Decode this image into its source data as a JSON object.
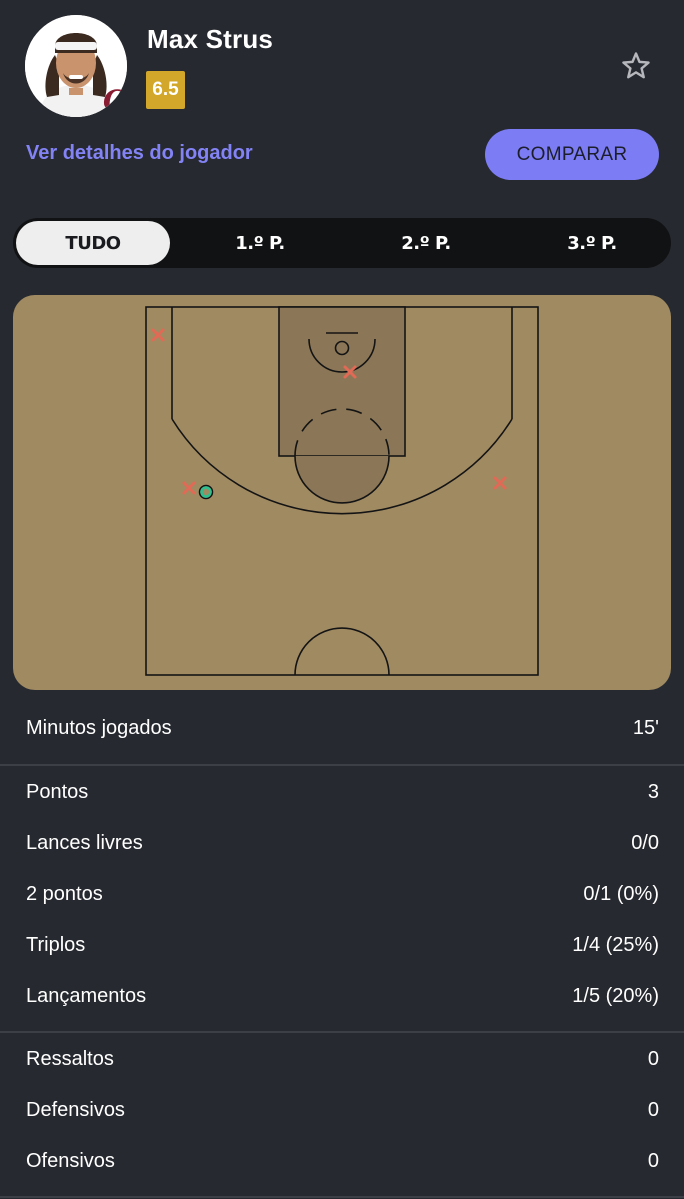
{
  "player": {
    "name": "Max Strus",
    "rating": "6.5",
    "details_link": "Ver detalhes do jogador",
    "compare_label": "COMPARAR",
    "accent_color": "#7c7cf4",
    "rating_color": "#d2a72a"
  },
  "tabs": [
    {
      "label": "TUDO",
      "active": true
    },
    {
      "label": "1.º P.",
      "active": false
    },
    {
      "label": "2.º P.",
      "active": false
    },
    {
      "label": "3.º P.",
      "active": false
    }
  ],
  "shot_chart": {
    "court_color": "#a08a62",
    "paint_color": "#8b7757",
    "made_color": "#2fbf8f",
    "missed_color": "#e06a55",
    "shots": [
      {
        "result": "missed",
        "type": "3PT",
        "zone": "left-corner"
      },
      {
        "result": "missed",
        "type": "2PT",
        "zone": "paint"
      },
      {
        "result": "missed",
        "type": "3PT",
        "zone": "left-wing"
      },
      {
        "result": "made",
        "type": "3PT",
        "zone": "left-wing"
      },
      {
        "result": "missed",
        "type": "3PT",
        "zone": "right-wing"
      }
    ]
  },
  "stats": {
    "minutes": {
      "label": "Minutos jogados",
      "value": "15'"
    },
    "scoring": [
      {
        "label": "Pontos",
        "value": "3"
      },
      {
        "label": "Lances livres",
        "value": "0/0"
      },
      {
        "label": "2 pontos",
        "value": "0/1 (0%)"
      },
      {
        "label": "Triplos",
        "value": "1/4 (25%)"
      },
      {
        "label": "Lançamentos",
        "value": "1/5 (20%)"
      }
    ],
    "rebounds": [
      {
        "label": "Ressaltos",
        "value": "0"
      },
      {
        "label": "Defensivos",
        "value": "0"
      },
      {
        "label": "Ofensivos",
        "value": "0"
      }
    ]
  }
}
